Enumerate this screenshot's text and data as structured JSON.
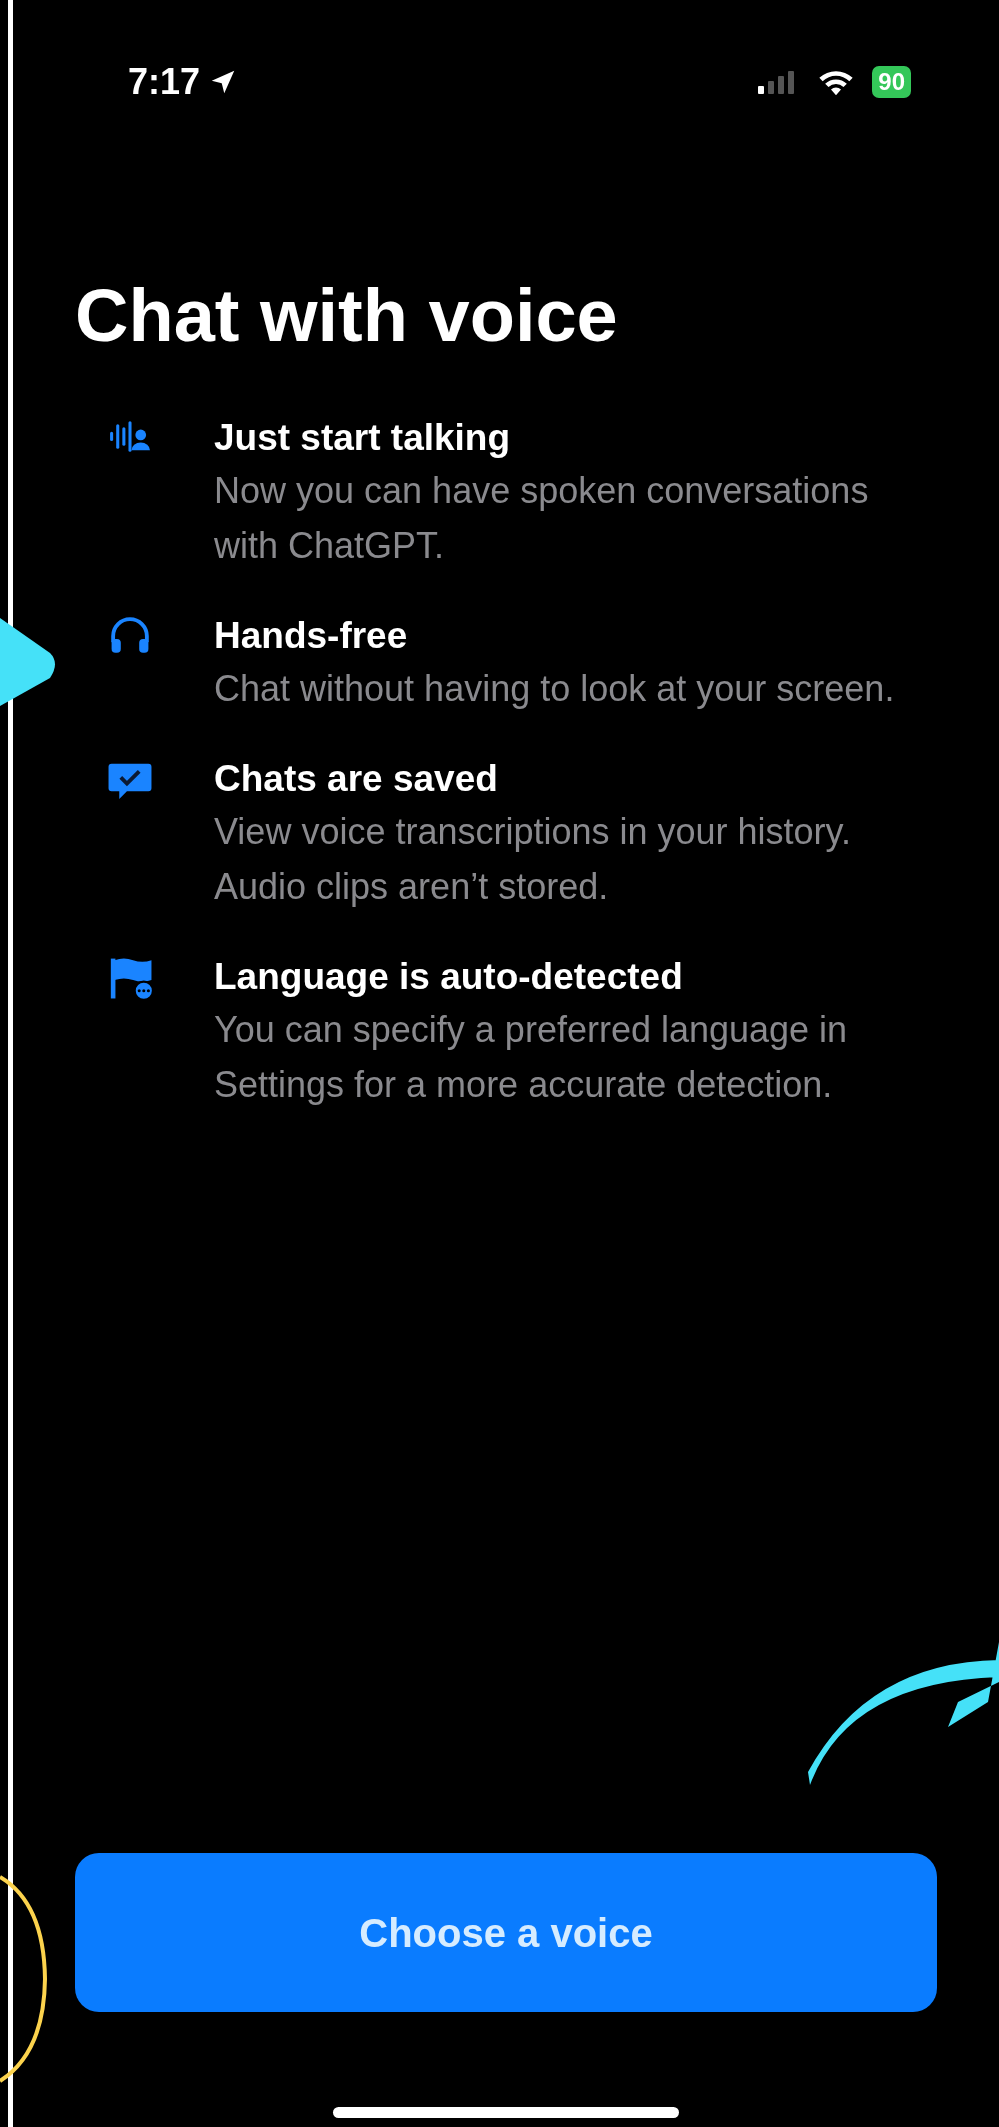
{
  "status_bar": {
    "time": "7:17",
    "battery": "90"
  },
  "title": "Chat with voice",
  "features": [
    {
      "title": "Just start talking",
      "description": "Now you can have spoken conversations with ChatGPT."
    },
    {
      "title": "Hands-free",
      "description": "Chat without having to look at your screen."
    },
    {
      "title": "Chats are saved",
      "description": "View voice transcriptions in your history. Audio clips aren’t stored."
    },
    {
      "title": "Language is auto-detected",
      "description": "You can specify a preferred language in Settings for a more accurate detection."
    }
  ],
  "button": {
    "label": "Choose a voice"
  }
}
